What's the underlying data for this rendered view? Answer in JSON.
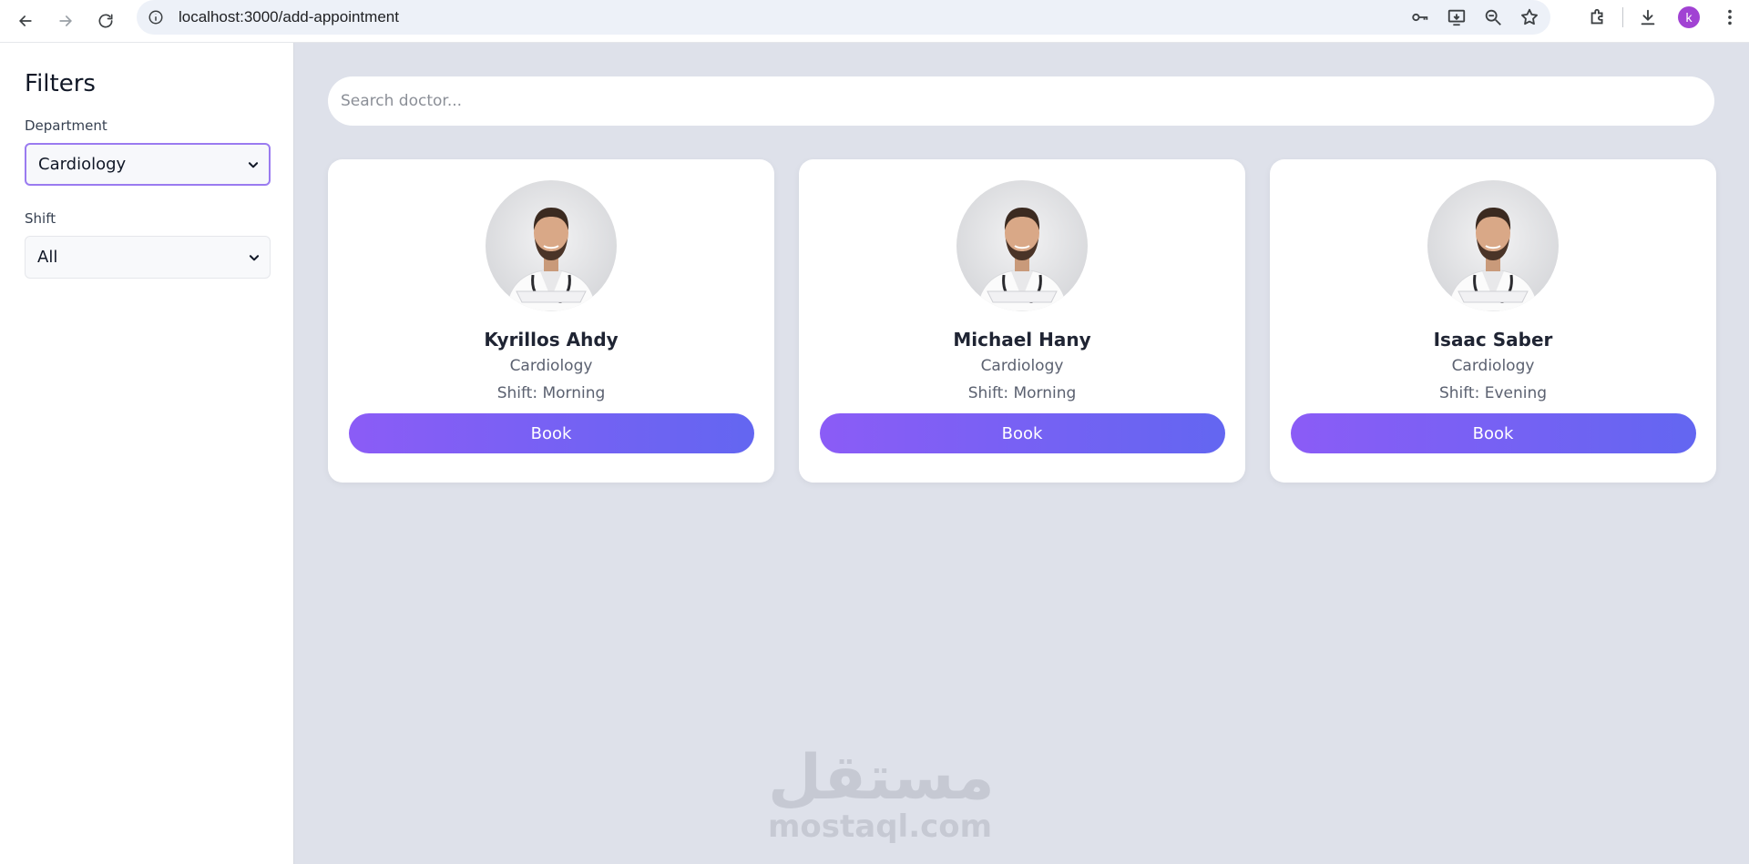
{
  "browser": {
    "url": "localhost:3000/add-appointment",
    "profile_initial": "k",
    "profile_color": "#a142d3"
  },
  "sidebar": {
    "title": "Filters",
    "department_label": "Department",
    "department_value": "Cardiology",
    "shift_label": "Shift",
    "shift_value": "All"
  },
  "search": {
    "placeholder": "Search doctor..."
  },
  "doctors": [
    {
      "name": "Kyrillos Ahdy",
      "department": "Cardiology",
      "shift": "Shift: Morning",
      "button": "Book"
    },
    {
      "name": "Michael Hany",
      "department": "Cardiology",
      "shift": "Shift: Morning",
      "button": "Book"
    },
    {
      "name": "Isaac Saber",
      "department": "Cardiology",
      "shift": "Shift: Evening",
      "button": "Book"
    }
  ],
  "watermark": {
    "arabic": "مستقل",
    "latin": "mostaql.com"
  },
  "colors": {
    "button_gradient_start": "#8b5cf6",
    "button_gradient_end": "#6366f1",
    "background": "#dee1ea"
  }
}
